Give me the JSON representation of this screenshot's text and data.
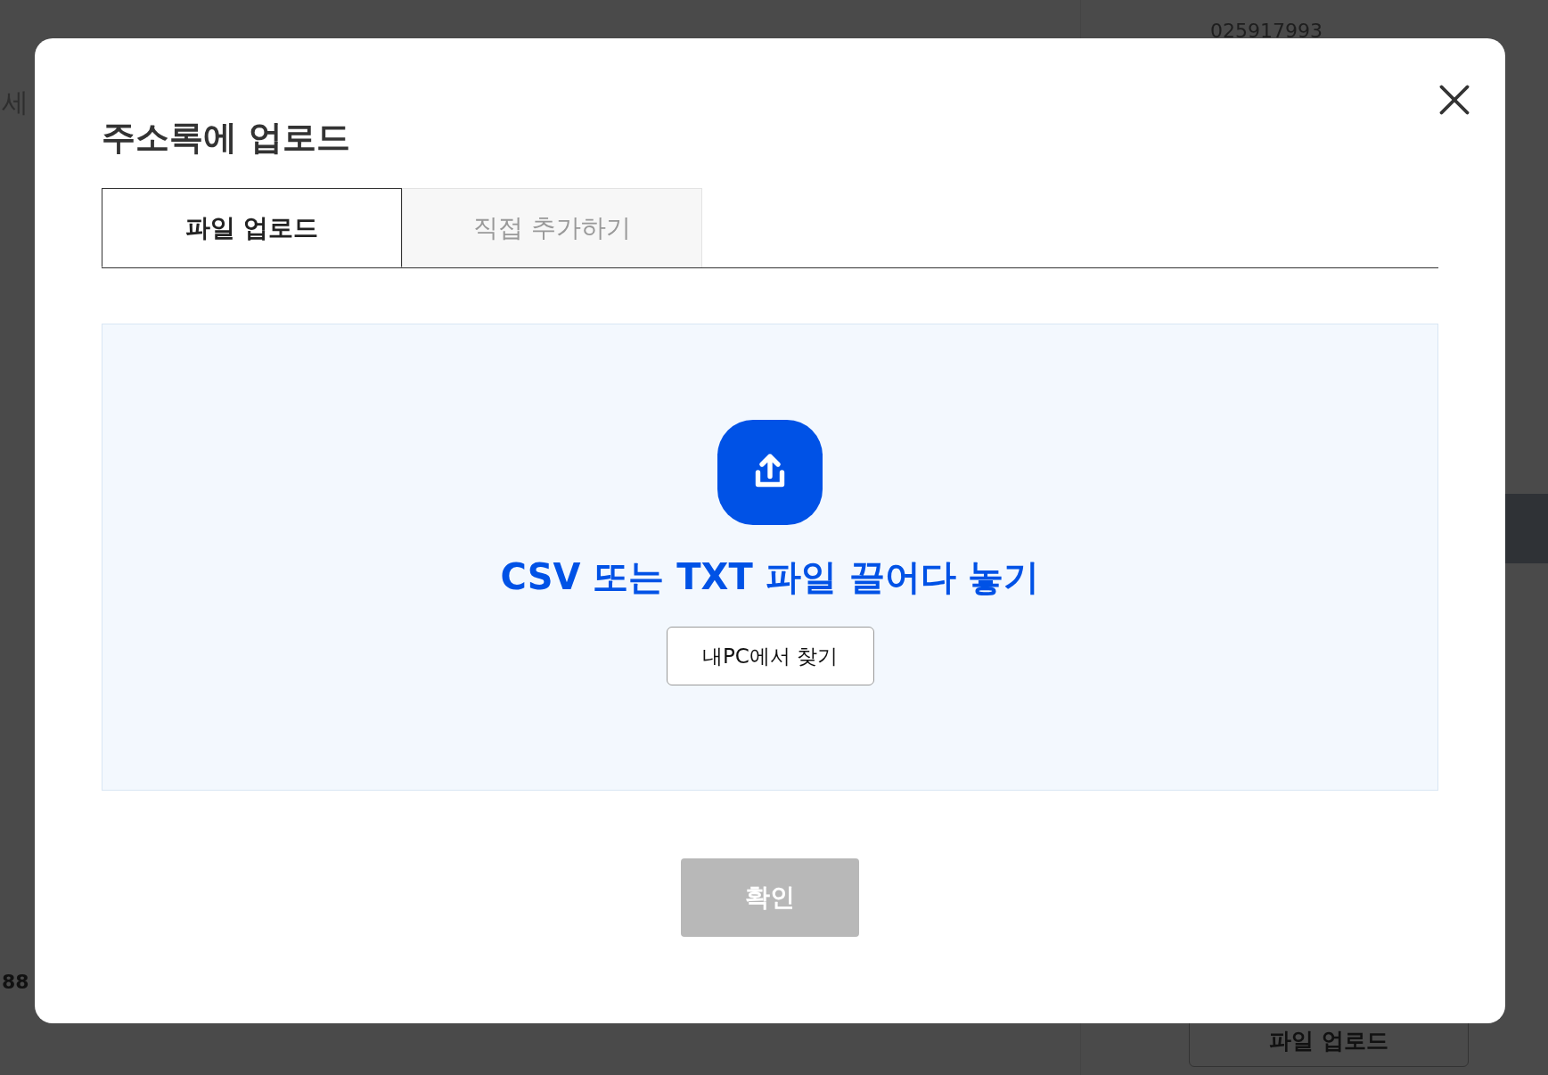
{
  "background": {
    "texts": [
      {
        "kind": "phone",
        "text": "025917993"
      },
      {
        "kind": "hint",
        "text": "세"
      },
      {
        "kind": "number",
        "text": "88"
      }
    ],
    "button": "파일 업로드"
  },
  "dialog": {
    "title": "주소록에 업로드",
    "tabs": [
      {
        "label": "파일 업로드",
        "selected": true
      },
      {
        "label": "직접 추가하기",
        "selected": false
      }
    ],
    "dropzone": {
      "heading": "CSV 또는 TXT 파일 끌어다 놓기",
      "browse_button": "내PC에서 찾기"
    },
    "confirm_button": {
      "label": "확인",
      "disabled": true
    }
  }
}
